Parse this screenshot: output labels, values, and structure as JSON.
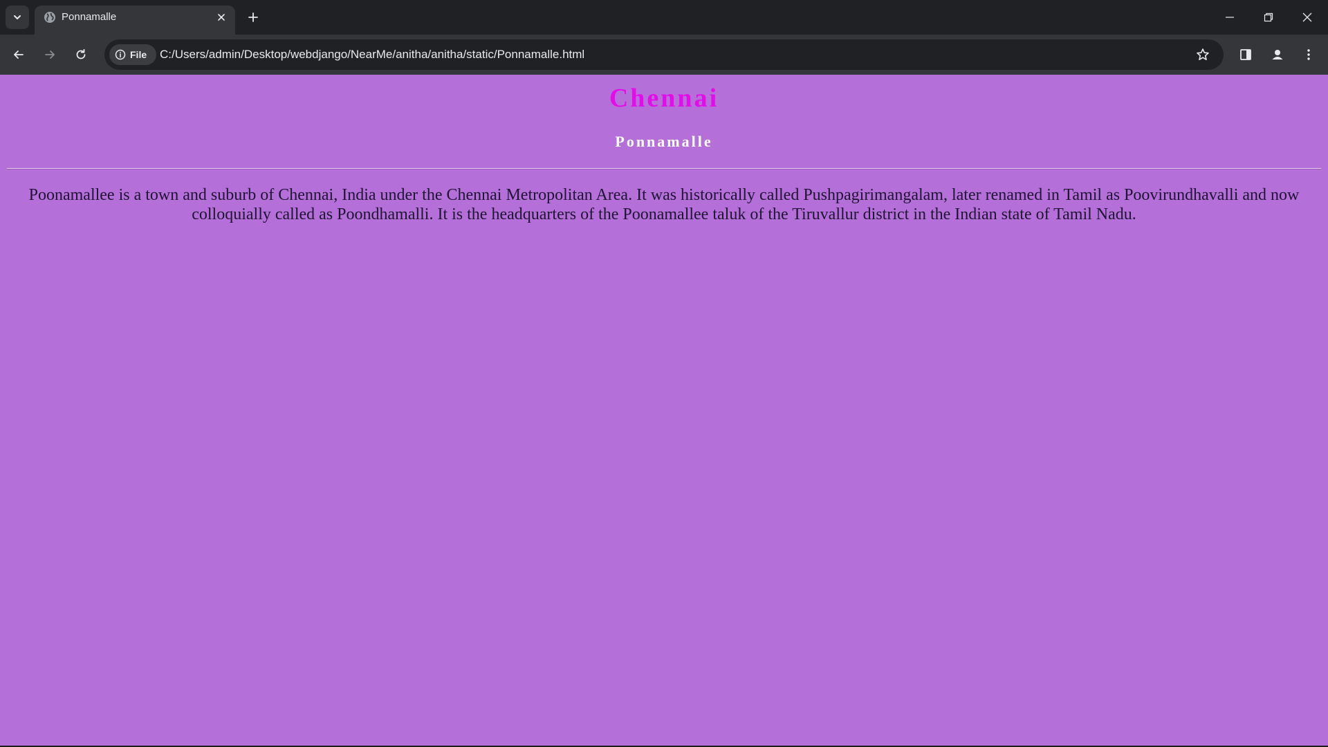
{
  "browser": {
    "tab": {
      "title": "Ponnamalle",
      "favicon": "globe-icon"
    },
    "new_tab_icon": "plus-icon",
    "address_bar": {
      "site_chip_label": "File",
      "url": "C:/Users/admin/Desktop/webdjango/NearMe/anitha/anitha/static/Ponnamalle.html"
    },
    "icons": {
      "back": "arrow-left-icon",
      "forward": "arrow-right-icon",
      "reload": "reload-icon",
      "info": "info-icon",
      "bookmark": "star-icon",
      "side_panel": "side-panel-icon",
      "profile": "profile-icon",
      "menu": "kebab-menu-icon",
      "minimize": "minimize-icon",
      "restore": "restore-icon",
      "close": "close-icon"
    }
  },
  "page": {
    "heading": "Chennai",
    "subheading": "Ponnamalle",
    "paragraph": "Poonamallee is a town and suburb of Chennai, India under the Chennai Metropolitan Area. It was historically called Pushpagirimangalam, later renamed in Tamil as Poovirundhavalli and now colloquially called as Poondhamalli. It is the headquarters of the Poonamallee taluk of the Tiruvallur district in the Indian state of Tamil Nadu."
  },
  "colors": {
    "page_background": "#b46fd9",
    "heading_color": "#e40ce8",
    "subheading_color": "#ffffff",
    "browser_chrome": "#202124",
    "toolbar": "#35363a"
  }
}
